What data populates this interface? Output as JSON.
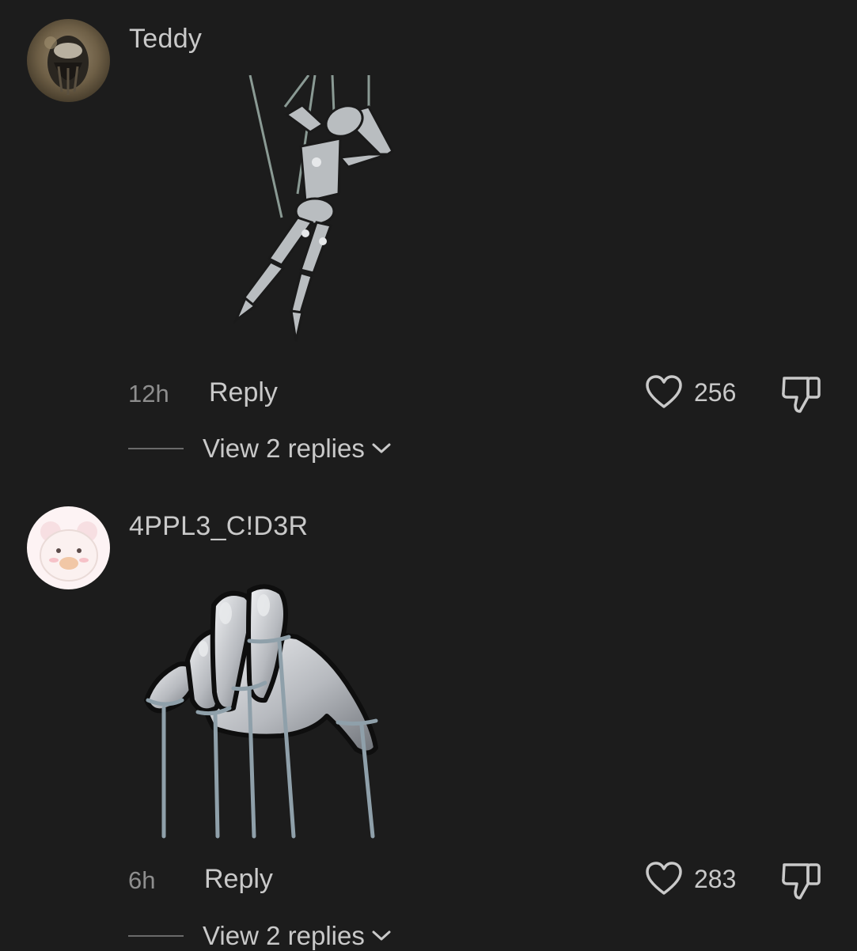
{
  "comments": [
    {
      "username": "Teddy",
      "avatar": "teddy-avatar",
      "sticker": "marionette-figure",
      "time": "12h",
      "reply_label": "Reply",
      "likes": "256",
      "view_replies": "View 2 replies"
    },
    {
      "username": "4PPL3_C!D3R",
      "avatar": "bear-avatar",
      "sticker": "puppeteer-hand",
      "time": "6h",
      "reply_label": "Reply",
      "likes": "283",
      "view_replies": "View 2 replies"
    }
  ],
  "icons": {
    "like": "heart-icon",
    "dislike": "thumbs-down-icon",
    "expand": "chevron-down-icon"
  }
}
